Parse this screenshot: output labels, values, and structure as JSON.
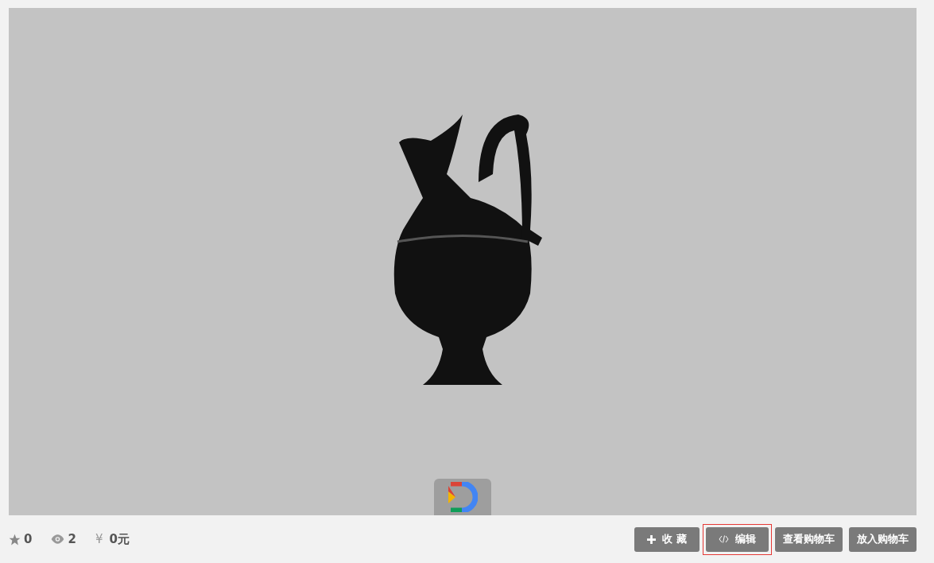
{
  "viewer": {
    "kind": "model"
  },
  "stats": [
    {
      "kind": "star",
      "value": "0"
    },
    {
      "kind": "eye",
      "value": "2"
    },
    {
      "kind": "currency",
      "symbol": "¥",
      "value": "0元"
    }
  ],
  "buttons": [
    {
      "kind": "plus",
      "label": "收 藏",
      "highlighted": false
    },
    {
      "kind": "code",
      "label": "编辑",
      "highlighted": true
    },
    {
      "kind": "none",
      "label": "查看购物车",
      "highlighted": false
    },
    {
      "kind": "none",
      "label": "放入购物车",
      "highlighted": false
    }
  ]
}
